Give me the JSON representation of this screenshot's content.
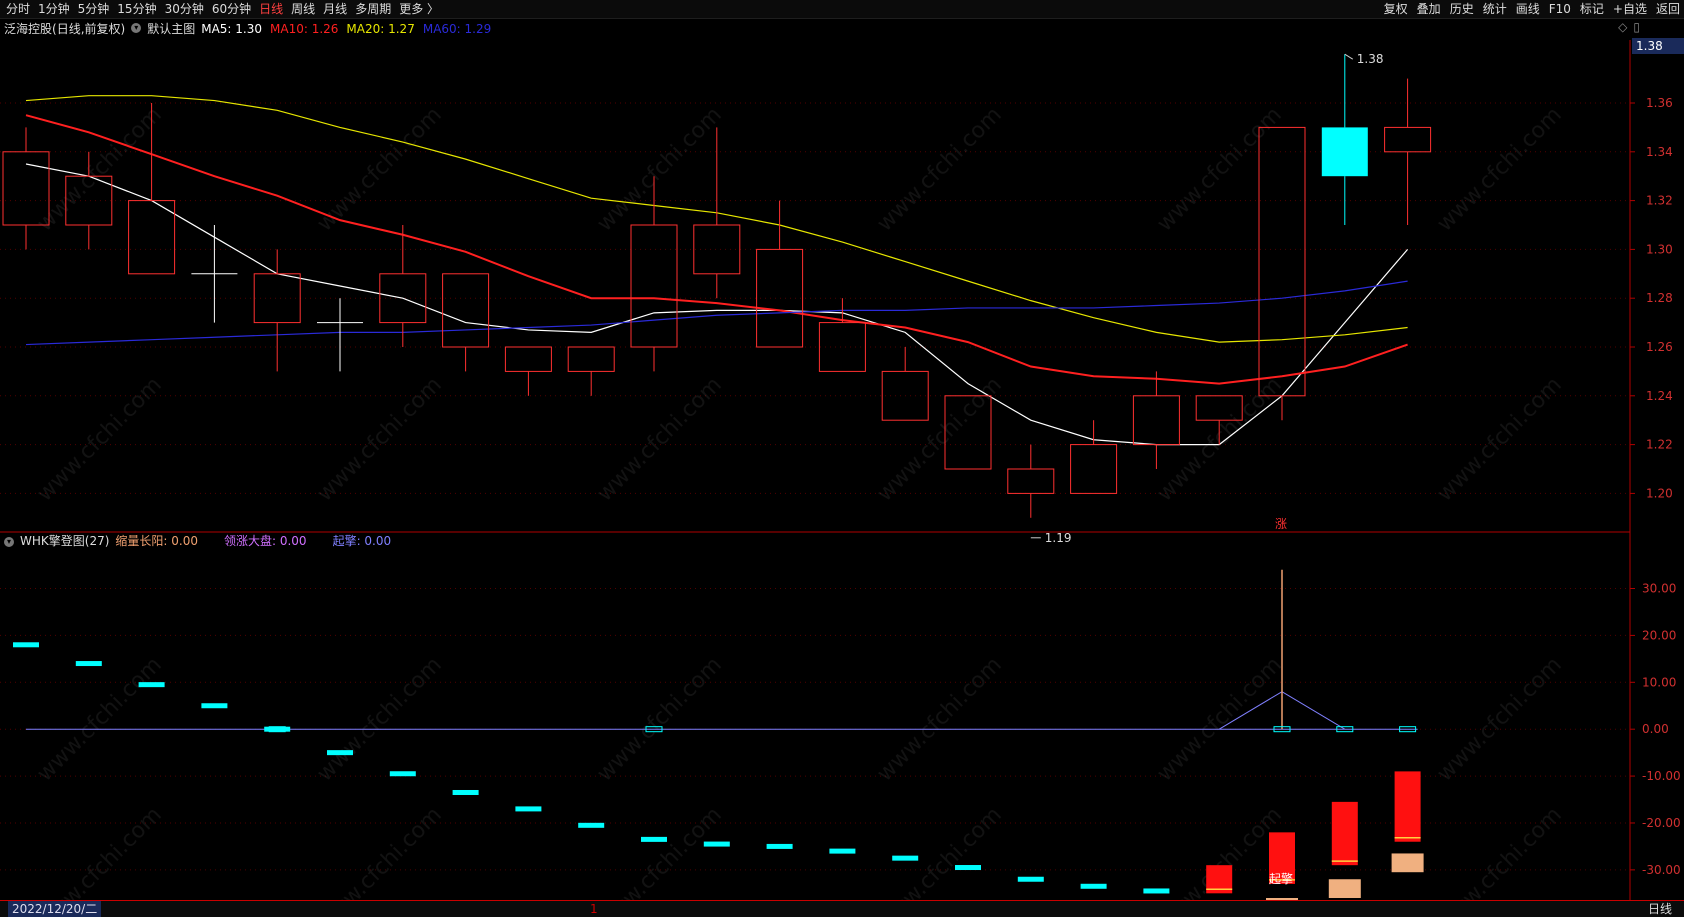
{
  "toolbar": {
    "periods": [
      "分时",
      "1分钟",
      "5分钟",
      "15分钟",
      "30分钟",
      "60分钟",
      "日线",
      "周线",
      "月线",
      "多周期",
      "更多 〉"
    ],
    "active_period": "日线",
    "right_buttons": [
      "复权",
      "叠加",
      "历史",
      "统计",
      "画线",
      "F10",
      "标记",
      "+自选",
      "返回"
    ]
  },
  "main": {
    "stock": "泛海控股",
    "stock_mode": "(日线,前复权)",
    "chart_label": "默认主图",
    "ma": [
      {
        "label": "MA5: 1.30",
        "color": "#ffffff"
      },
      {
        "label": "MA10: 1.26",
        "color": "#ff2020"
      },
      {
        "label": "MA20: 1.27",
        "color": "#e6e600"
      },
      {
        "label": "MA60: 1.29",
        "color": "#2a2ad8"
      }
    ],
    "current_price": "1.38",
    "high_label": "1.38",
    "low_label": "1.19",
    "zhang_label": "涨",
    "y_ticks": [
      "1.36",
      "1.34",
      "1.32",
      "1.30",
      "1.28",
      "1.26",
      "1.24",
      "1.22",
      "1.20"
    ]
  },
  "sub": {
    "indicator": "WHK擎登图(27)",
    "items": [
      {
        "label": "缩量长阳: 0.00",
        "color": "#f0a070"
      },
      {
        "label": "领涨大盘: 0.00",
        "color": "#d070ff"
      },
      {
        "label": "起擎: 0.00",
        "color": "#8080ff"
      }
    ],
    "qiqing_label": "起擎",
    "y_ticks": [
      "30.00",
      "20.00",
      "10.00",
      "0.00",
      "-10.00",
      "-20.00",
      "-30.00"
    ]
  },
  "bottom": {
    "date": "2022/12/20/二",
    "marker": "1",
    "period_label": "日线"
  },
  "watermark": "www.cfchi.com",
  "chart_data": {
    "type": "candlestick",
    "ylim": [
      1.185,
      1.385
    ],
    "candles": [
      {
        "o": 1.31,
        "h": 1.35,
        "l": 1.3,
        "c": 1.34
      },
      {
        "o": 1.31,
        "h": 1.34,
        "l": 1.3,
        "c": 1.33
      },
      {
        "o": 1.29,
        "h": 1.36,
        "l": 1.29,
        "c": 1.32
      },
      {
        "o": 1.29,
        "h": 1.31,
        "l": 1.27,
        "c": 1.29
      },
      {
        "o": 1.27,
        "h": 1.3,
        "l": 1.25,
        "c": 1.29
      },
      {
        "o": 1.27,
        "h": 1.28,
        "l": 1.25,
        "c": 1.27
      },
      {
        "o": 1.27,
        "h": 1.31,
        "l": 1.26,
        "c": 1.29
      },
      {
        "o": 1.26,
        "h": 1.29,
        "l": 1.25,
        "c": 1.29
      },
      {
        "o": 1.25,
        "h": 1.26,
        "l": 1.24,
        "c": 1.26
      },
      {
        "o": 1.25,
        "h": 1.26,
        "l": 1.24,
        "c": 1.26
      },
      {
        "o": 1.26,
        "h": 1.33,
        "l": 1.25,
        "c": 1.31
      },
      {
        "o": 1.29,
        "h": 1.35,
        "l": 1.28,
        "c": 1.31
      },
      {
        "o": 1.26,
        "h": 1.32,
        "l": 1.26,
        "c": 1.3
      },
      {
        "o": 1.25,
        "h": 1.28,
        "l": 1.25,
        "c": 1.27
      },
      {
        "o": 1.23,
        "h": 1.26,
        "l": 1.23,
        "c": 1.25
      },
      {
        "o": 1.21,
        "h": 1.24,
        "l": 1.21,
        "c": 1.24
      },
      {
        "o": 1.2,
        "h": 1.22,
        "l": 1.19,
        "c": 1.21
      },
      {
        "o": 1.2,
        "h": 1.23,
        "l": 1.2,
        "c": 1.22
      },
      {
        "o": 1.22,
        "h": 1.25,
        "l": 1.21,
        "c": 1.24
      },
      {
        "o": 1.23,
        "h": 1.24,
        "l": 1.22,
        "c": 1.24
      },
      {
        "o": 1.24,
        "h": 1.35,
        "l": 1.23,
        "c": 1.35
      },
      {
        "o": 1.35,
        "h": 1.38,
        "l": 1.31,
        "c": 1.33
      },
      {
        "o": 1.34,
        "h": 1.37,
        "l": 1.31,
        "c": 1.35
      }
    ],
    "ma5": [
      1.335,
      1.33,
      1.32,
      1.305,
      1.29,
      1.285,
      1.28,
      1.27,
      1.267,
      1.266,
      1.274,
      1.275,
      1.275,
      1.274,
      1.266,
      1.245,
      1.23,
      1.222,
      1.22,
      1.22,
      1.24,
      1.27,
      1.3
    ],
    "ma10": [
      1.355,
      1.348,
      1.339,
      1.33,
      1.322,
      1.312,
      1.306,
      1.299,
      1.289,
      1.28,
      1.28,
      1.278,
      1.275,
      1.271,
      1.268,
      1.262,
      1.252,
      1.248,
      1.247,
      1.245,
      1.248,
      1.252,
      1.261
    ],
    "ma20": [
      1.361,
      1.363,
      1.363,
      1.361,
      1.357,
      1.35,
      1.344,
      1.337,
      1.329,
      1.321,
      1.318,
      1.315,
      1.31,
      1.303,
      1.295,
      1.287,
      1.279,
      1.272,
      1.266,
      1.262,
      1.263,
      1.265,
      1.268
    ],
    "ma60": [
      1.261,
      1.262,
      1.263,
      1.264,
      1.265,
      1.266,
      1.266,
      1.267,
      1.268,
      1.269,
      1.271,
      1.273,
      1.274,
      1.275,
      1.275,
      1.276,
      1.276,
      1.276,
      1.277,
      1.278,
      1.28,
      1.283,
      1.287
    ],
    "sub": {
      "ylim": [
        -36,
        38
      ],
      "cyan_dash": [
        18,
        14,
        9.5,
        5,
        0,
        -5,
        -9.5,
        -13.5,
        -17,
        -20.5,
        -23.5,
        -24.5,
        -25,
        -26,
        -27.5,
        -29.5,
        -32,
        -33.5,
        -34.5,
        null,
        null,
        null,
        null
      ],
      "small_boxes": [
        4,
        10,
        20,
        21,
        22
      ],
      "spike": {
        "index": 20,
        "value": 34
      },
      "red_bars": [
        {
          "index": 19,
          "top": -29,
          "bottom": -35
        },
        {
          "index": 20,
          "top": -22,
          "bottom": -33
        },
        {
          "index": 21,
          "top": -15.5,
          "bottom": -29
        },
        {
          "index": 22,
          "top": -9,
          "bottom": -24
        }
      ],
      "tan_bars": [
        {
          "index": 20,
          "top": -36,
          "bottom": -40
        },
        {
          "index": 21,
          "top": -32,
          "bottom": -36
        },
        {
          "index": 22,
          "top": -26.5,
          "bottom": -30.5
        }
      ]
    }
  }
}
